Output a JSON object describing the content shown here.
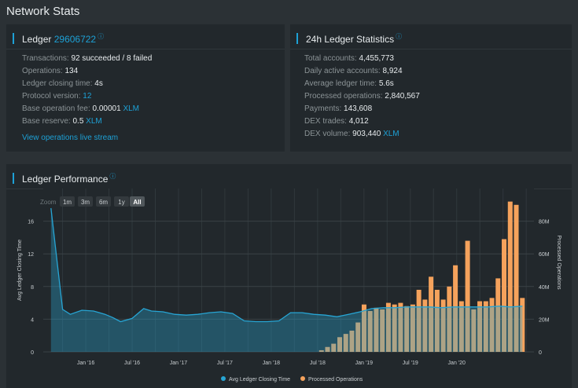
{
  "page": {
    "title": "Network Stats"
  },
  "ledger": {
    "title_prefix": "Ledger",
    "ledger_number": "29606722",
    "rows": [
      {
        "label": "Transactions:",
        "value": "92 succeeded / 8 failed",
        "unit": ""
      },
      {
        "label": "Operations:",
        "value": "134",
        "unit": ""
      },
      {
        "label": "Ledger closing time:",
        "value": "4s",
        "unit": ""
      },
      {
        "label": "Protocol version:",
        "value": "",
        "unit": "12"
      },
      {
        "label": "Base operation fee:",
        "value": "0.00001",
        "unit": "XLM"
      },
      {
        "label": "Base reserve:",
        "value": "0.5",
        "unit": "XLM"
      }
    ],
    "live_stream_link": "View operations live stream"
  },
  "stats24h": {
    "title": "24h Ledger Statistics",
    "rows": [
      {
        "label": "Total accounts:",
        "value": "4,455,773",
        "unit": ""
      },
      {
        "label": "Daily active accounts:",
        "value": "8,924",
        "unit": ""
      },
      {
        "label": "Average ledger time:",
        "value": "5.6s",
        "unit": ""
      },
      {
        "label": "Processed operations:",
        "value": "2,840,567",
        "unit": ""
      },
      {
        "label": "Payments:",
        "value": "143,608",
        "unit": ""
      },
      {
        "label": "DEX trades:",
        "value": "4,012",
        "unit": ""
      },
      {
        "label": "DEX volume:",
        "value": "903,440",
        "unit": "XLM"
      }
    ]
  },
  "performance": {
    "title": "Ledger Performance",
    "zoom_label": "Zoom",
    "zoom_buttons": [
      "1m",
      "3m",
      "6m",
      "1y",
      "All"
    ],
    "zoom_selected": "All"
  },
  "colors": {
    "accent": "#1da1d6",
    "line": "#27a5d4",
    "bars": "#f5a25c"
  },
  "chart_data": {
    "type": "bar",
    "x_tick_labels": [
      "Jan '16",
      "Jul '16",
      "Jan '17",
      "Jul '17",
      "Jan '18",
      "Jul '18",
      "Jan '19",
      "Jul '19",
      "Jan '20"
    ],
    "left_axis": {
      "title": "Avg Ledger Closing Time",
      "ticks": [
        0,
        4,
        8,
        12,
        16
      ],
      "ylim": [
        0,
        20
      ]
    },
    "right_axis": {
      "title": "Processed Operations",
      "ticks": [
        "0",
        "20M",
        "40M",
        "60M",
        "80M"
      ],
      "ylim": [
        0,
        100
      ]
    },
    "series": [
      {
        "name": "Avg Ledger Closing Time",
        "type": "area",
        "x_months": [
          0,
          1.5,
          2.5,
          4,
          5.5,
          7,
          8,
          9,
          10.5,
          12,
          13,
          14.5,
          16,
          17.5,
          19,
          20.5,
          22,
          23.5,
          25,
          26.5,
          28,
          29.5,
          31,
          32.5,
          34,
          35.5,
          37,
          38.5,
          40,
          41.5,
          43,
          44.5,
          46,
          47.5,
          49,
          50.5,
          52,
          53.5,
          55,
          56.5,
          58,
          59.5,
          61
        ],
        "values": [
          17.6,
          5.2,
          4.6,
          5.1,
          5.0,
          4.6,
          4.2,
          3.7,
          4.1,
          5.3,
          5.0,
          4.9,
          4.6,
          4.5,
          4.6,
          4.8,
          4.9,
          4.7,
          3.8,
          3.7,
          3.7,
          3.8,
          4.8,
          4.8,
          4.6,
          4.5,
          4.3,
          4.6,
          4.9,
          5.3,
          5.4,
          5.4,
          5.5,
          5.5,
          5.5,
          5.4,
          5.5,
          5.5,
          5.5,
          5.5,
          5.6,
          5.5,
          5.6
        ]
      },
      {
        "name": "Processed Operations",
        "type": "bar",
        "unit": "M",
        "x_months": [
          35,
          36,
          37,
          38,
          39,
          40,
          41,
          42,
          43,
          44,
          45,
          46,
          47,
          48,
          49,
          50,
          51,
          52,
          53,
          54,
          55,
          56,
          57,
          58,
          59,
          60,
          61
        ],
        "values": [
          1,
          3,
          5,
          9,
          11,
          13,
          18,
          29,
          25,
          27,
          26,
          30,
          29,
          30,
          28,
          29,
          38,
          32,
          46,
          38,
          32,
          40,
          53,
          31,
          68,
          26,
          31,
          31,
          33,
          45,
          69,
          92,
          90,
          33
        ]
      }
    ]
  }
}
